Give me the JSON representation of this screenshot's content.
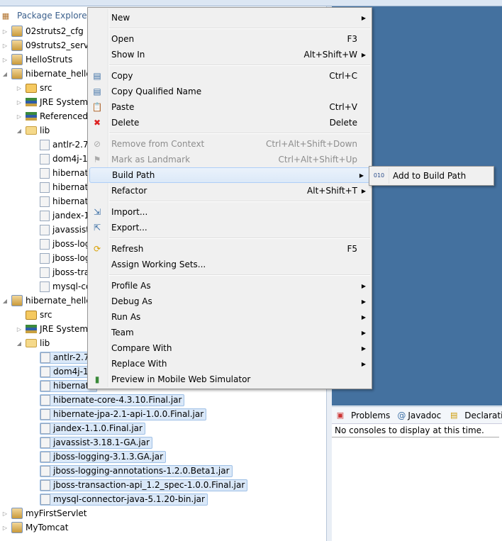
{
  "explorer": {
    "title": "Package Explorer",
    "close": "✕",
    "tree": [
      {
        "label": "02struts2_cfg",
        "depth": 0,
        "twisty": "closed",
        "icon": "project-error-icon"
      },
      {
        "label": "09struts2_servle",
        "depth": 0,
        "twisty": "closed",
        "icon": "project-error-icon"
      },
      {
        "label": "HelloStruts",
        "depth": 0,
        "twisty": "closed",
        "icon": "project-icon"
      },
      {
        "label": "hibernate_hello",
        "depth": 0,
        "twisty": "open",
        "icon": "java-project-icon"
      },
      {
        "label": "src",
        "depth": 1,
        "twisty": "closed",
        "icon": "source-folder-icon"
      },
      {
        "label": "JRE System",
        "depth": 1,
        "twisty": "closed",
        "icon": "library-icon"
      },
      {
        "label": "Referenced",
        "depth": 1,
        "twisty": "closed",
        "icon": "library-icon"
      },
      {
        "label": "lib",
        "depth": 1,
        "twisty": "open",
        "icon": "folder-icon"
      },
      {
        "label": "antlr-2.7.",
        "depth": 2,
        "icon": "jar-icon"
      },
      {
        "label": "dom4j-1",
        "depth": 2,
        "icon": "jar-icon"
      },
      {
        "label": "hibernate",
        "depth": 2,
        "icon": "jar-icon"
      },
      {
        "label": "hibernate",
        "depth": 2,
        "icon": "jar-icon"
      },
      {
        "label": "hibernate",
        "depth": 2,
        "icon": "jar-icon"
      },
      {
        "label": "jandex-1",
        "depth": 2,
        "icon": "jar-icon"
      },
      {
        "label": "javassist-",
        "depth": 2,
        "icon": "jar-icon"
      },
      {
        "label": "jboss-log",
        "depth": 2,
        "icon": "jar-icon"
      },
      {
        "label": "jboss-log",
        "depth": 2,
        "icon": "jar-icon"
      },
      {
        "label": "jboss-tra",
        "depth": 2,
        "icon": "jar-icon"
      },
      {
        "label": "mysql-cc",
        "depth": 2,
        "icon": "jar-icon"
      },
      {
        "label": "hibernate_hello",
        "depth": 0,
        "twisty": "open",
        "icon": "java-project-icon"
      },
      {
        "label": "src",
        "depth": 1,
        "icon": "source-folder-icon"
      },
      {
        "label": "JRE System",
        "depth": 1,
        "twisty": "closed",
        "icon": "library-icon"
      },
      {
        "label": "lib",
        "depth": 1,
        "twisty": "open",
        "icon": "folder-icon"
      },
      {
        "label": "antlr-2.7.",
        "depth": 2,
        "icon": "jar-icon",
        "selected": true
      },
      {
        "label": "dom4j-1",
        "depth": 2,
        "icon": "jar-icon",
        "selected": true
      },
      {
        "label": "hibernate",
        "depth": 2,
        "icon": "jar-icon",
        "selected": true
      },
      {
        "label": "hibernate-core-4.3.10.Final.jar",
        "depth": 2,
        "icon": "jar-icon",
        "selected": true
      },
      {
        "label": "hibernate-jpa-2.1-api-1.0.0.Final.jar",
        "depth": 2,
        "icon": "jar-icon",
        "selected": true
      },
      {
        "label": "jandex-1.1.0.Final.jar",
        "depth": 2,
        "icon": "jar-icon",
        "selected": true
      },
      {
        "label": "javassist-3.18.1-GA.jar",
        "depth": 2,
        "icon": "jar-icon",
        "selected": true
      },
      {
        "label": "jboss-logging-3.1.3.GA.jar",
        "depth": 2,
        "icon": "jar-icon",
        "selected": true
      },
      {
        "label": "jboss-logging-annotations-1.2.0.Beta1.jar",
        "depth": 2,
        "icon": "jar-icon",
        "selected": true
      },
      {
        "label": "jboss-transaction-api_1.2_spec-1.0.0.Final.jar",
        "depth": 2,
        "icon": "jar-icon",
        "selected": true
      },
      {
        "label": "mysql-connector-java-5.1.20-bin.jar",
        "depth": 2,
        "icon": "jar-icon",
        "selected": true
      },
      {
        "label": "myFirstServlet",
        "depth": 0,
        "twisty": "closed",
        "icon": "project-icon"
      },
      {
        "label": "MyTomcat",
        "depth": 0,
        "twisty": "closed",
        "icon": "project-icon"
      }
    ]
  },
  "context_menu": {
    "groups": [
      [
        {
          "label": "New",
          "submenu": true
        }
      ],
      [
        {
          "label": "Open",
          "accel": "F3"
        },
        {
          "label": "Show In",
          "accel": "Alt+Shift+W",
          "submenu": true
        }
      ],
      [
        {
          "label": "Copy",
          "accel": "Ctrl+C",
          "icon": "copy-icon"
        },
        {
          "label": "Copy Qualified Name",
          "icon": "copy-qualified-icon"
        },
        {
          "label": "Paste",
          "accel": "Ctrl+V",
          "icon": "paste-icon"
        },
        {
          "label": "Delete",
          "accel": "Delete",
          "icon": "delete-icon"
        }
      ],
      [
        {
          "label": "Remove from Context",
          "accel": "Ctrl+Alt+Shift+Down",
          "disabled": true,
          "icon": "remove-context-icon"
        },
        {
          "label": "Mark as Landmark",
          "accel": "Ctrl+Alt+Shift+Up",
          "disabled": true,
          "icon": "landmark-icon"
        },
        {
          "label": "Build Path",
          "submenu": true,
          "highlighted": true
        },
        {
          "label": "Refactor",
          "accel": "Alt+Shift+T",
          "submenu": true
        }
      ],
      [
        {
          "label": "Import...",
          "icon": "import-icon"
        },
        {
          "label": "Export...",
          "icon": "export-icon"
        }
      ],
      [
        {
          "label": "Refresh",
          "accel": "F5",
          "icon": "refresh-icon"
        },
        {
          "label": "Assign Working Sets..."
        }
      ],
      [
        {
          "label": "Profile As",
          "submenu": true
        },
        {
          "label": "Debug As",
          "submenu": true
        },
        {
          "label": "Run As",
          "submenu": true
        },
        {
          "label": "Team",
          "submenu": true
        },
        {
          "label": "Compare With",
          "submenu": true
        },
        {
          "label": "Replace With",
          "submenu": true
        },
        {
          "label": "Preview in Mobile Web Simulator",
          "icon": "mobile-simulator-icon"
        }
      ]
    ]
  },
  "submenu": {
    "label": "Add to Build Path",
    "icon": "build-path-icon",
    "glyph": "010"
  },
  "bottom_panel": {
    "tabs": [
      {
        "label": "Problems",
        "icon": "problems-icon"
      },
      {
        "label": "Javadoc",
        "icon": "javadoc-icon"
      },
      {
        "label": "Declaration",
        "icon": "declaration-icon"
      }
    ],
    "message": "No consoles to display at this time."
  },
  "colors": {
    "editor_bg": "#44719f",
    "selection": "#dae8f8",
    "menu_bg": "#f0f0f0"
  }
}
